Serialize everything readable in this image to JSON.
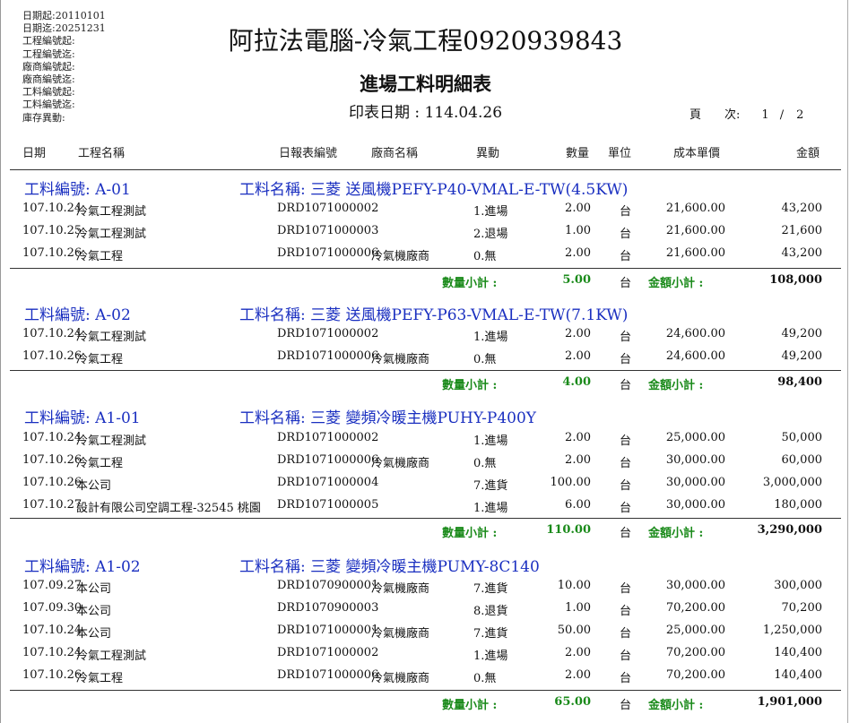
{
  "filters": [
    "日期起:20110101",
    "日期迄:20251231",
    "工程編號起:",
    "工程編號迄:",
    "廠商編號起:",
    "廠商編號迄:",
    "工料編號起:",
    "工料編號迄:",
    "庫存異動:"
  ],
  "company": "阿拉法電腦-冷氣工程0920939843",
  "report_title": "進場工料明細表",
  "print_date": "印表日期 : 114.04.26",
  "page_info": {
    "label1": "頁",
    "label2": "次:",
    "current": "1",
    "sep": "/",
    "total": "2"
  },
  "columns": {
    "date": "日期",
    "name": "工程名稱",
    "doc": "日報表編號",
    "vendor": "廠商名稱",
    "move": "異動",
    "qty": "數量",
    "unit": "單位",
    "cost": "成本單價",
    "amount": "金額"
  },
  "subtotal_labels": {
    "qty": "數量小計 :",
    "amount": "金額小計 :"
  },
  "groups": [
    {
      "code": "工料編號: A-01",
      "name": "工料名稱: 三菱 送風機PEFY-P40-VMAL-E-TW(4.5KW)",
      "rows": [
        {
          "date": "107.10.24",
          "name": "冷氣工程測試",
          "doc": "DRD1071000002",
          "vendor": "",
          "move": "1.進場",
          "qty": "2.00",
          "unit": "台",
          "cost": "21,600.00",
          "amount": "43,200"
        },
        {
          "date": "107.10.25",
          "name": "冷氣工程測試",
          "doc": "DRD1071000003",
          "vendor": "",
          "move": "2.退場",
          "qty": "1.00",
          "unit": "台",
          "cost": "21,600.00",
          "amount": "21,600"
        },
        {
          "date": "107.10.26",
          "name": "冷氣工程",
          "doc": "DRD1071000006",
          "vendor": "冷氣機廠商",
          "move": "0.無",
          "qty": "2.00",
          "unit": "台",
          "cost": "21,600.00",
          "amount": "43,200"
        }
      ],
      "subtotal": {
        "qty": "5.00",
        "unit": "台",
        "amount": "108,000"
      }
    },
    {
      "code": "工料編號: A-02",
      "name": "工料名稱: 三菱 送風機PEFY-P63-VMAL-E-TW(7.1KW)",
      "rows": [
        {
          "date": "107.10.24",
          "name": "冷氣工程測試",
          "doc": "DRD1071000002",
          "vendor": "",
          "move": "1.進場",
          "qty": "2.00",
          "unit": "台",
          "cost": "24,600.00",
          "amount": "49,200"
        },
        {
          "date": "107.10.26",
          "name": "冷氣工程",
          "doc": "DRD1071000006",
          "vendor": "冷氣機廠商",
          "move": "0.無",
          "qty": "2.00",
          "unit": "台",
          "cost": "24,600.00",
          "amount": "49,200"
        }
      ],
      "subtotal": {
        "qty": "4.00",
        "unit": "台",
        "amount": "98,400"
      }
    },
    {
      "code": "工料編號: A1-01",
      "name": "工料名稱: 三菱 變頻冷暖主機PUHY-P400Y",
      "rows": [
        {
          "date": "107.10.24",
          "name": "冷氣工程測試",
          "doc": "DRD1071000002",
          "vendor": "",
          "move": "1.進場",
          "qty": "2.00",
          "unit": "台",
          "cost": "25,000.00",
          "amount": "50,000"
        },
        {
          "date": "107.10.26",
          "name": "冷氣工程",
          "doc": "DRD1071000006",
          "vendor": "冷氣機廠商",
          "move": "0.無",
          "qty": "2.00",
          "unit": "台",
          "cost": "30,000.00",
          "amount": "60,000"
        },
        {
          "date": "107.10.26",
          "name": "本公司",
          "doc": "DRD1071000004",
          "vendor": "",
          "move": "7.進貨",
          "qty": "100.00",
          "unit": "台",
          "cost": "30,000.00",
          "amount": "3,000,000"
        },
        {
          "date": "107.10.27",
          "name": "設計有限公司空調工程-32545 桃園",
          "doc": "DRD1071000005",
          "vendor": "",
          "move": "1.進場",
          "qty": "6.00",
          "unit": "台",
          "cost": "30,000.00",
          "amount": "180,000"
        }
      ],
      "subtotal": {
        "qty": "110.00",
        "unit": "台",
        "amount": "3,290,000"
      }
    },
    {
      "code": "工料編號: A1-02",
      "name": "工料名稱: 三菱 變頻冷暖主機PUMY-8C140",
      "rows": [
        {
          "date": "107.09.27",
          "name": "本公司",
          "doc": "DRD1070900001",
          "vendor": "冷氣機廠商",
          "move": "7.進貨",
          "qty": "10.00",
          "unit": "台",
          "cost": "30,000.00",
          "amount": "300,000"
        },
        {
          "date": "107.09.30",
          "name": "本公司",
          "doc": "DRD1070900003",
          "vendor": "",
          "move": "8.退貨",
          "qty": "1.00",
          "unit": "台",
          "cost": "70,200.00",
          "amount": "70,200"
        },
        {
          "date": "107.10.24",
          "name": "本公司",
          "doc": "DRD1071000001",
          "vendor": "冷氣機廠商",
          "move": "7.進貨",
          "qty": "50.00",
          "unit": "台",
          "cost": "25,000.00",
          "amount": "1,250,000"
        },
        {
          "date": "107.10.24",
          "name": "冷氣工程測試",
          "doc": "DRD1071000002",
          "vendor": "",
          "move": "1.進場",
          "qty": "2.00",
          "unit": "台",
          "cost": "70,200.00",
          "amount": "140,400"
        },
        {
          "date": "107.10.26",
          "name": "冷氣工程",
          "doc": "DRD1071000006",
          "vendor": "冷氣機廠商",
          "move": "0.無",
          "qty": "2.00",
          "unit": "台",
          "cost": "70,200.00",
          "amount": "140,400"
        }
      ],
      "subtotal": {
        "qty": "65.00",
        "unit": "台",
        "amount": "1,901,000"
      }
    }
  ]
}
